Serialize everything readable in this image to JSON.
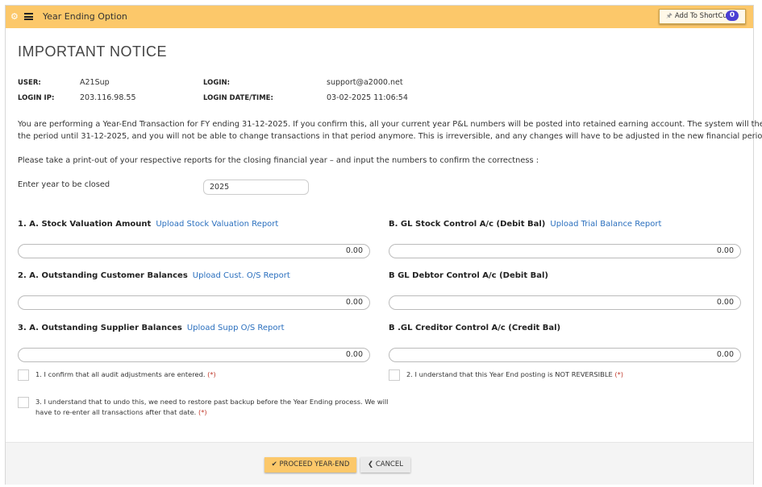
{
  "topbar": {
    "title": "Year Ending Option",
    "shortcut_label": "Add To ShortCut",
    "shortcut_count": "0"
  },
  "notice": {
    "title": "IMPORTANT NOTICE"
  },
  "info": {
    "user_label": "USER:",
    "user_value": "A21Sup",
    "login_label": "LOGIN:",
    "login_value": "support@a2000.net",
    "login_ip_label": "LOGIN IP:",
    "login_ip_value": "203.116.98.55",
    "login_datetime_label": "LOGIN DATE/TIME:",
    "login_datetime_value": "03-02-2025 11:06:54"
  },
  "message": {
    "line1": "You are performing a Year-End Transaction for FY ending 31-12-2025. If you confirm this, all your current year P&L numbers will be posted into retained earning account. The system will then lock",
    "line2": "the period until 31-12-2025, and you will not be able to change transactions in that period anymore. This is irreversible, and any changes will have to be adjusted in the new financial period.",
    "line3": "Please take a print-out of your respective reports for the closing financial year – and input the numbers to confirm the correctness :"
  },
  "year": {
    "label": "Enter year to be closed",
    "value": "2025"
  },
  "sections": {
    "stock_label": "1. A. Stock Valuation Amount",
    "stock_link": "Upload Stock Valuation Report",
    "stock_value": "0.00",
    "gl_stock_label": "B. GL Stock Control A/c (Debit Bal)",
    "gl_stock_link": "Upload Trial Balance Report",
    "gl_stock_value": "0.00",
    "customer_label": "2. A. Outstanding Customer Balances",
    "customer_link": "Upload Cust. O/S Report",
    "customer_value": "0.00",
    "gl_debtor_label": "B GL Debtor Control A/c (Debit Bal)",
    "gl_debtor_value": "0.00",
    "supplier_label": "3. A. Outstanding Supplier Balances",
    "supplier_link": "Upload Supp O/S Report",
    "supplier_value": "0.00",
    "gl_creditor_label": "B .GL Creditor Control A/c (Credit Bal)",
    "gl_creditor_value": "0.00"
  },
  "confirmations": {
    "c1": "1. I confirm that all audit adjustments are entered.",
    "c2": "2. I understand that this Year End posting is NOT REVERSIBLE",
    "c3_line1": "3. I understand that to undo this, we need to restore past backup before the Year Ending process. We will",
    "c3_line2": "have to re-enter all transactions after that date.",
    "required_mark": "(*)"
  },
  "footer": {
    "proceed_label": "PROCEED YEAR-END",
    "cancel_label": "CANCEL"
  }
}
